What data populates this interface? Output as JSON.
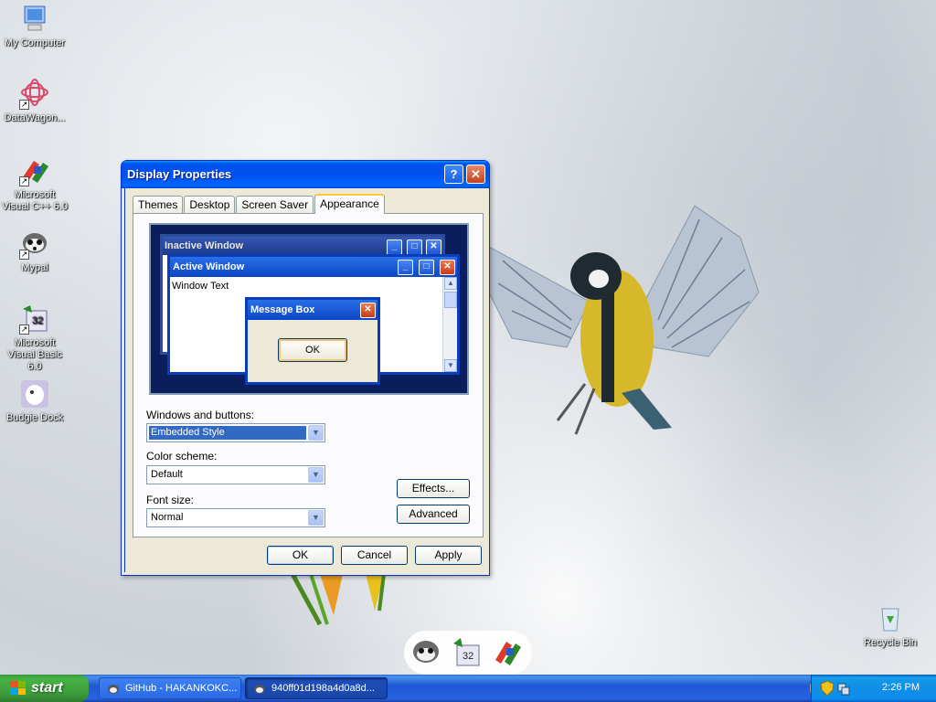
{
  "desktop": {
    "icons": [
      {
        "label": "My Computer"
      },
      {
        "label": "DataWagon..."
      },
      {
        "label": "Microsoft Visual C++ 6.0"
      },
      {
        "label": "Mypal"
      },
      {
        "label": "Microsoft Visual Basic 6.0"
      },
      {
        "label": "Budgie Dock"
      },
      {
        "label": "Recycle Bin"
      }
    ]
  },
  "dialog": {
    "title": "Display Properties",
    "tabs": [
      {
        "label": "Themes"
      },
      {
        "label": "Desktop"
      },
      {
        "label": "Screen Saver"
      },
      {
        "label": "Appearance"
      }
    ],
    "active_tab": "Appearance",
    "preview": {
      "inactive_title": "Inactive Window",
      "active_title": "Active Window",
      "window_text": "Window Text",
      "message_title": "Message Box",
      "message_ok": "OK"
    },
    "windows_buttons_label": "Windows and buttons:",
    "windows_buttons_value": "Embedded Style",
    "color_scheme_label": "Color scheme:",
    "color_scheme_value": "Default",
    "font_size_label": "Font size:",
    "font_size_value": "Normal",
    "effects_button": "Effects...",
    "advanced_button": "Advanced",
    "ok_button": "OK",
    "cancel_button": "Cancel",
    "apply_button": "Apply"
  },
  "taskbar": {
    "start_label": "start",
    "tasks": [
      {
        "label": "GitHub - HAKANKOKC..."
      },
      {
        "label": "940ff01d198a4d0a8d..."
      }
    ],
    "clock": "2:26 PM"
  },
  "colors": {
    "xp_blue": "#0053ee",
    "start_green": "#3c9c3c",
    "dialog_bg": "#ece9d8"
  }
}
